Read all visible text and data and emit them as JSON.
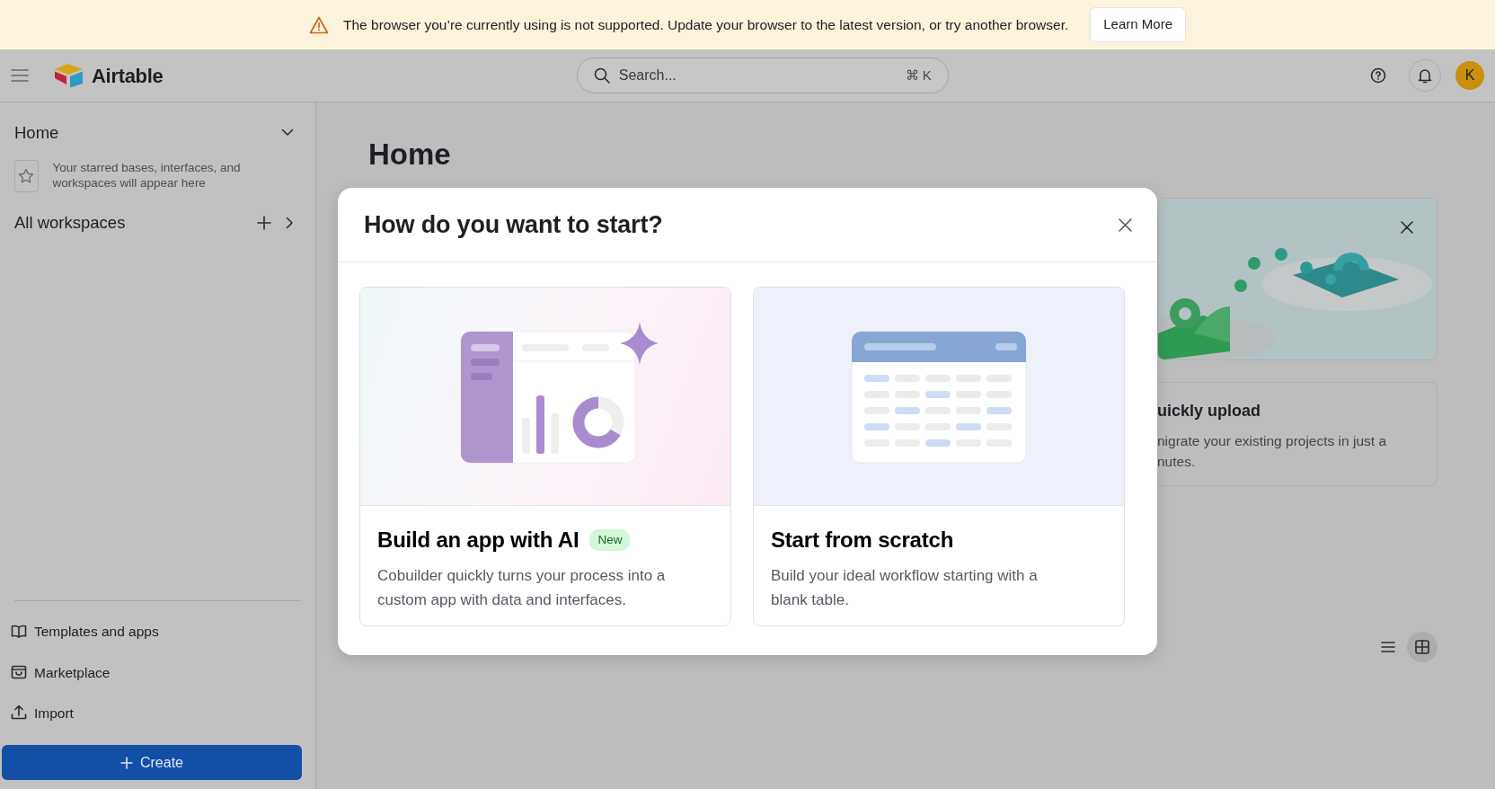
{
  "banner": {
    "message": "The browser you’re currently using is not supported. Update your browser to the latest version, or try another browser.",
    "button": "Learn More"
  },
  "header": {
    "brand": "Airtable",
    "search": {
      "placeholder": "Search...",
      "shortcut": "⌘ K"
    },
    "avatar": "K"
  },
  "sidebar": {
    "home_title": "Home",
    "starred_hint": "Your starred bases, interfaces, and workspaces will appear here",
    "workspaces_title": "All workspaces",
    "links": [
      {
        "kind": "templates",
        "label": "Templates and apps"
      },
      {
        "kind": "marketplace",
        "label": "Marketplace"
      },
      {
        "kind": "import",
        "label": "Import"
      }
    ],
    "create_button": "Create"
  },
  "main": {
    "title": "Home",
    "promo": {
      "title": "uickly upload",
      "description_lines": [
        "nigrate your existing projects in just a",
        "nutes."
      ]
    },
    "view_toggle": [
      {
        "kind": "list",
        "selected": false
      },
      {
        "kind": "grid",
        "selected": true
      }
    ]
  },
  "modal": {
    "title": "How do you want to start?",
    "options": [
      {
        "kind": "ai",
        "title": "Build an app with AI",
        "badge": "New",
        "description": "Cobuilder quickly turns your process into a custom app with data and interfaces."
      },
      {
        "kind": "scratch",
        "title": "Start from scratch",
        "description": "Build your ideal workflow starting with a blank table."
      }
    ]
  }
}
